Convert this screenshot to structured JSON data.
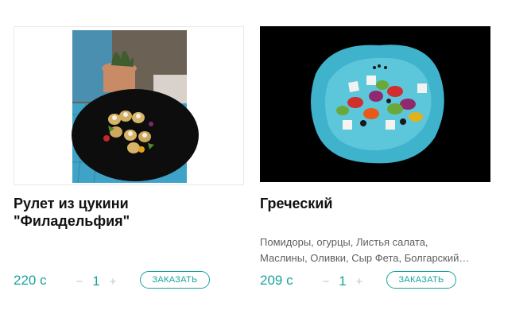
{
  "products": [
    {
      "title": "Рулет из цукини \"Филадельфия\"",
      "description_lines": [],
      "price": "220 с",
      "qty_minus": "−",
      "quantity": "1",
      "qty_plus": "+",
      "order_label": "ЗАКАЗАТЬ"
    },
    {
      "title": "Греческий",
      "description_lines": [
        "Помидоры, огурцы, Листья салата,",
        "Маслины, Оливки, Сыр Фета, Болгарский…"
      ],
      "price": "209 с",
      "qty_minus": "−",
      "quantity": "1",
      "qty_plus": "+",
      "order_label": "ЗАКАЗАТЬ"
    }
  ],
  "colors": {
    "accent": "#1aa39b",
    "text": "#111111",
    "muted": "#5f5f5f"
  }
}
